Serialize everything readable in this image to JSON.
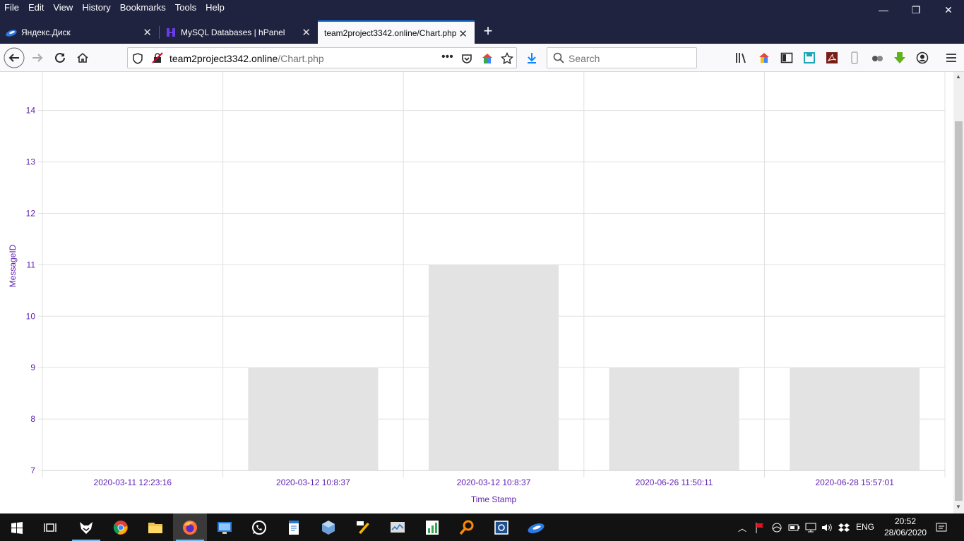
{
  "menu": [
    "File",
    "Edit",
    "View",
    "History",
    "Bookmarks",
    "Tools",
    "Help"
  ],
  "window_controls": {
    "minimize": "—",
    "restore": "❐",
    "close": "✕"
  },
  "tabs": [
    {
      "title": "Яндекс.Диск",
      "active": false
    },
    {
      "title": "MySQL Databases | hPanel",
      "active": false
    },
    {
      "title": "team2project3342.online/Chart.php",
      "active": true
    }
  ],
  "address_bar": {
    "host": "team2project3342.online",
    "path": "/Chart.php"
  },
  "search": {
    "placeholder": "Search"
  },
  "chart_data": {
    "type": "bar",
    "xlabel": "Time Stamp",
    "ylabel": "MessageID",
    "categories": [
      "2020-03-11 12:23:16",
      "2020-03-12 10:8:37",
      "2020-03-12 10:8:37",
      "2020-06-26 11:50:11",
      "2020-06-28 15:57:01"
    ],
    "values": [
      7,
      9,
      11,
      9,
      9
    ],
    "ylim": [
      7,
      14.75
    ],
    "yticks": [
      7,
      8,
      9,
      10,
      11,
      12,
      13,
      14
    ],
    "grid": true,
    "colors": {
      "bar": "#e3e3e3",
      "axis_text": "#5d1fb0",
      "grid": "#e0e0e0"
    }
  },
  "taskbar": {
    "apps": [
      "start-icon",
      "task-view-icon",
      "fox-app-icon",
      "chrome-icon",
      "file-explorer-icon",
      "firefox-icon",
      "remote-desktop-icon",
      "whatsapp-icon",
      "notepad-icon",
      "virtualbox-icon",
      "tools-icon",
      "task-manager-icon",
      "spreadsheet-icon",
      "search-tool-icon",
      "settings-app-icon",
      "yandex-disk-icon"
    ],
    "language": "ENG",
    "time": "20:52",
    "date": "28/06/2020"
  }
}
